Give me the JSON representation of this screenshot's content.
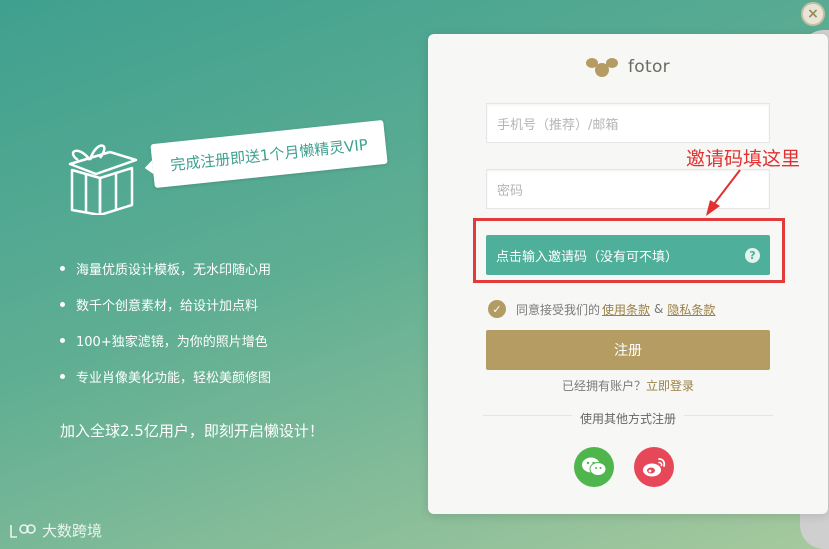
{
  "left": {
    "promo": "完成注册即送1个月懒精灵VIP",
    "features": [
      "海量优质设计模板，无水印随心用",
      "数千个创意素材，给设计加点料",
      "100+独家滤镜，为你的照片增色",
      "专业肖像美化功能，轻松美颜修图"
    ],
    "join": "加入全球2.5亿用户，即刻开启懒设计！",
    "watermark": "大数跨境"
  },
  "close": "×",
  "logo": {
    "text": "fotor"
  },
  "form": {
    "phone_placeholder": "手机号（推荐）/邮箱",
    "password_placeholder": "密码",
    "invite_label": "点击输入邀请码（没有可不填）",
    "help": "?",
    "agree_prefix": "同意接受我们的",
    "terms": "使用条款",
    "amp": "&",
    "privacy": "隐私条款",
    "register": "注册",
    "have_account": "已经拥有账户？",
    "login_now": "立即登录",
    "other_methods": "使用其他方式注册"
  },
  "annotation": "邀请码填这里",
  "colors": {
    "accent_teal": "#4eaf9b",
    "gold": "#b49c63",
    "wechat": "#4fb54d",
    "weibo": "#e6485a",
    "annotation_red": "#e23131"
  }
}
